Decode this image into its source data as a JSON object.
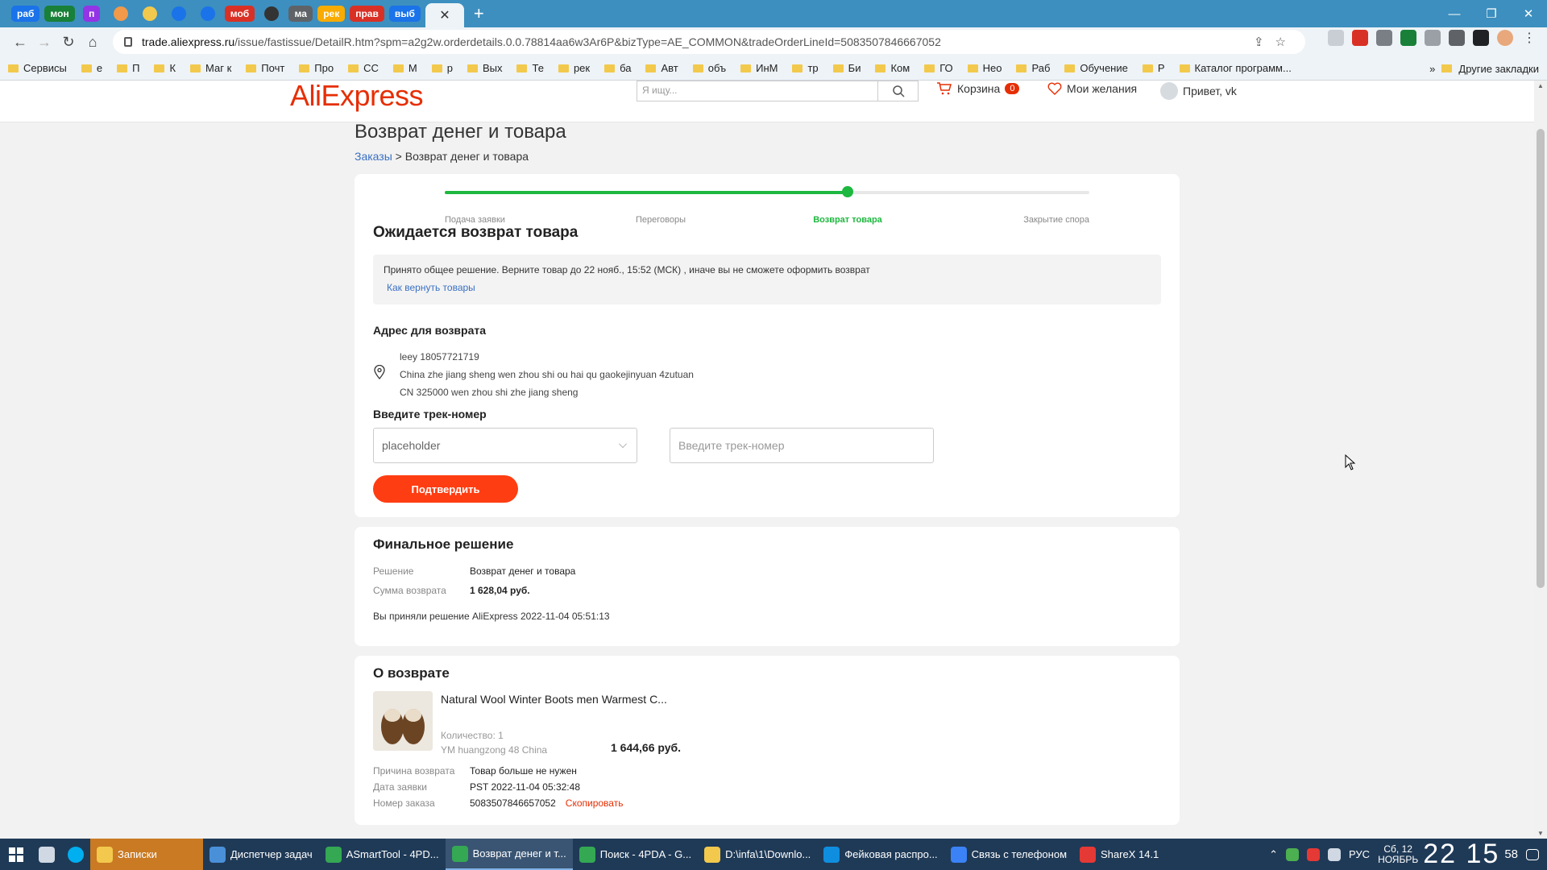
{
  "browser": {
    "tabs": [
      {
        "label": "раб",
        "color": "#1a73e8"
      },
      {
        "label": "мон",
        "color": "#188038"
      },
      {
        "label": "п",
        "color": "#9334e6"
      },
      {
        "label": "",
        "color": "#f2994a"
      },
      {
        "label": "",
        "color": "#f2c94c"
      },
      {
        "label": "",
        "color": "#1a73e8"
      },
      {
        "label": "",
        "color": "#1a73e8"
      },
      {
        "label": "моб",
        "color": "#d93025"
      },
      {
        "label": "",
        "color": "#333333"
      },
      {
        "label": "ма",
        "color": "#5f6368"
      },
      {
        "label": "рек",
        "color": "#f9ab00"
      },
      {
        "label": "прав",
        "color": "#d93025"
      },
      {
        "label": "выб",
        "color": "#1a73e8"
      }
    ],
    "active_tab_close": "✕",
    "new_tab": "+",
    "window_controls": {
      "minimize": "—",
      "maximize": "❐",
      "close": "✕"
    },
    "url_host": "trade.aliexpress.ru",
    "url_path": "/issue/fastissue/DetailR.htm?spm=a2g2w.orderdetails.0.0.78814aa6w3Ar6P&bizType=AE_COMMON&tradeOrderLineId=5083507846667052",
    "bookmarks": [
      "Сервисы",
      "е",
      "П",
      "К",
      "Маг к",
      "Почт",
      "Про",
      "СС",
      "М",
      "р",
      "Вых",
      "Те",
      "рек",
      "ба",
      "Авт",
      "объ",
      "ИнМ",
      "тр",
      "Би",
      "Ком",
      "ГО",
      "Нео",
      "Раб",
      "Обучение",
      "Р",
      "Каталог программ..."
    ],
    "bookmarks_more": "»",
    "other_bookmarks": "Другие закладки"
  },
  "site": {
    "logo": "AliExpress",
    "search_placeholder": "Я ищу...",
    "cart_label": "Корзина",
    "cart_count": "0",
    "wishlist_label": "Мои желания",
    "greeting": "Привет, vk"
  },
  "page": {
    "title": "Возврат денег и товара",
    "breadcrumb_link": "Заказы",
    "breadcrumb_sep": " > ",
    "breadcrumb_current": "Возврат денег и товара"
  },
  "stepper": {
    "progress": 0.625,
    "steps": [
      {
        "label": "Подача заявки",
        "active": false
      },
      {
        "label": "Переговоры",
        "active": false
      },
      {
        "label": "Возврат товара",
        "active": true
      },
      {
        "label": "Закрытие спора",
        "active": false
      }
    ]
  },
  "status": {
    "heading": "Ожидается возврат товара",
    "notice": "Принято общее решение. Верните товар до 22 нояб., 15:52 (МСК) , иначе вы не сможете оформить возврат",
    "how_to_link": "Как вернуть товары"
  },
  "return_address": {
    "heading": "Адрес для возврата",
    "line1": "leey 18057721719",
    "line2": "China zhe jiang sheng wen zhou shi ou hai qu gaokejinyuan 4zutuan",
    "line3": "CN 325000 wen zhou shi zhe jiang sheng"
  },
  "tracking": {
    "heading": "Введите трек-номер",
    "carrier_value": "placeholder",
    "input_placeholder": "Введите трек-номер",
    "confirm_label": "Подтвердить"
  },
  "final_decision": {
    "heading": "Финальное решение",
    "decision_key": "Решение",
    "decision_value": "Возврат денег и товара",
    "amount_key": "Сумма возврата",
    "amount_value": "1 628,04 руб.",
    "accepted_text": "Вы приняли решение AliExpress 2022-11-04 05:51:13"
  },
  "about_return": {
    "heading": "О возврате",
    "product_name": "Natural Wool Winter Boots men Warmest C...",
    "quantity": "Количество: 1",
    "variant": "YM huangzong 48 China",
    "price": "1 644,66 руб.",
    "reason_key": "Причина возврата",
    "reason_value": "Товар больше не нужен",
    "date_key": "Дата заявки",
    "date_value": "PST 2022-11-04 05:32:48",
    "order_key": "Номер заказа",
    "order_value": "5083507846657052",
    "copy_label": "Скопировать"
  },
  "taskbar": {
    "items": [
      {
        "label": "Записки",
        "color": "#f2c94c",
        "style": "highlight"
      },
      {
        "label": "Диспетчер задач",
        "color": "#4a90d9",
        "style": ""
      },
      {
        "label": "ASmartTool - 4PD...",
        "color": "#34a853",
        "style": ""
      },
      {
        "label": "Возврат денег и т...",
        "color": "#34a853",
        "style": "active"
      },
      {
        "label": "Поиск - 4PDA - G...",
        "color": "#34a853",
        "style": ""
      },
      {
        "label": "D:\\infa\\1\\Downlo...",
        "color": "#f2c94c",
        "style": ""
      },
      {
        "label": "Фейковая распро...",
        "color": "#0f8ee0",
        "style": ""
      },
      {
        "label": "Связь с телефоном",
        "color": "#3b82f6",
        "style": ""
      },
      {
        "label": "ShareX 14.1",
        "color": "#e53935",
        "style": ""
      }
    ],
    "lang": "РУС",
    "date_line1": "Сб, 12",
    "date_line2": "НОЯБРЬ",
    "time": "22 15",
    "seconds": "58"
  }
}
